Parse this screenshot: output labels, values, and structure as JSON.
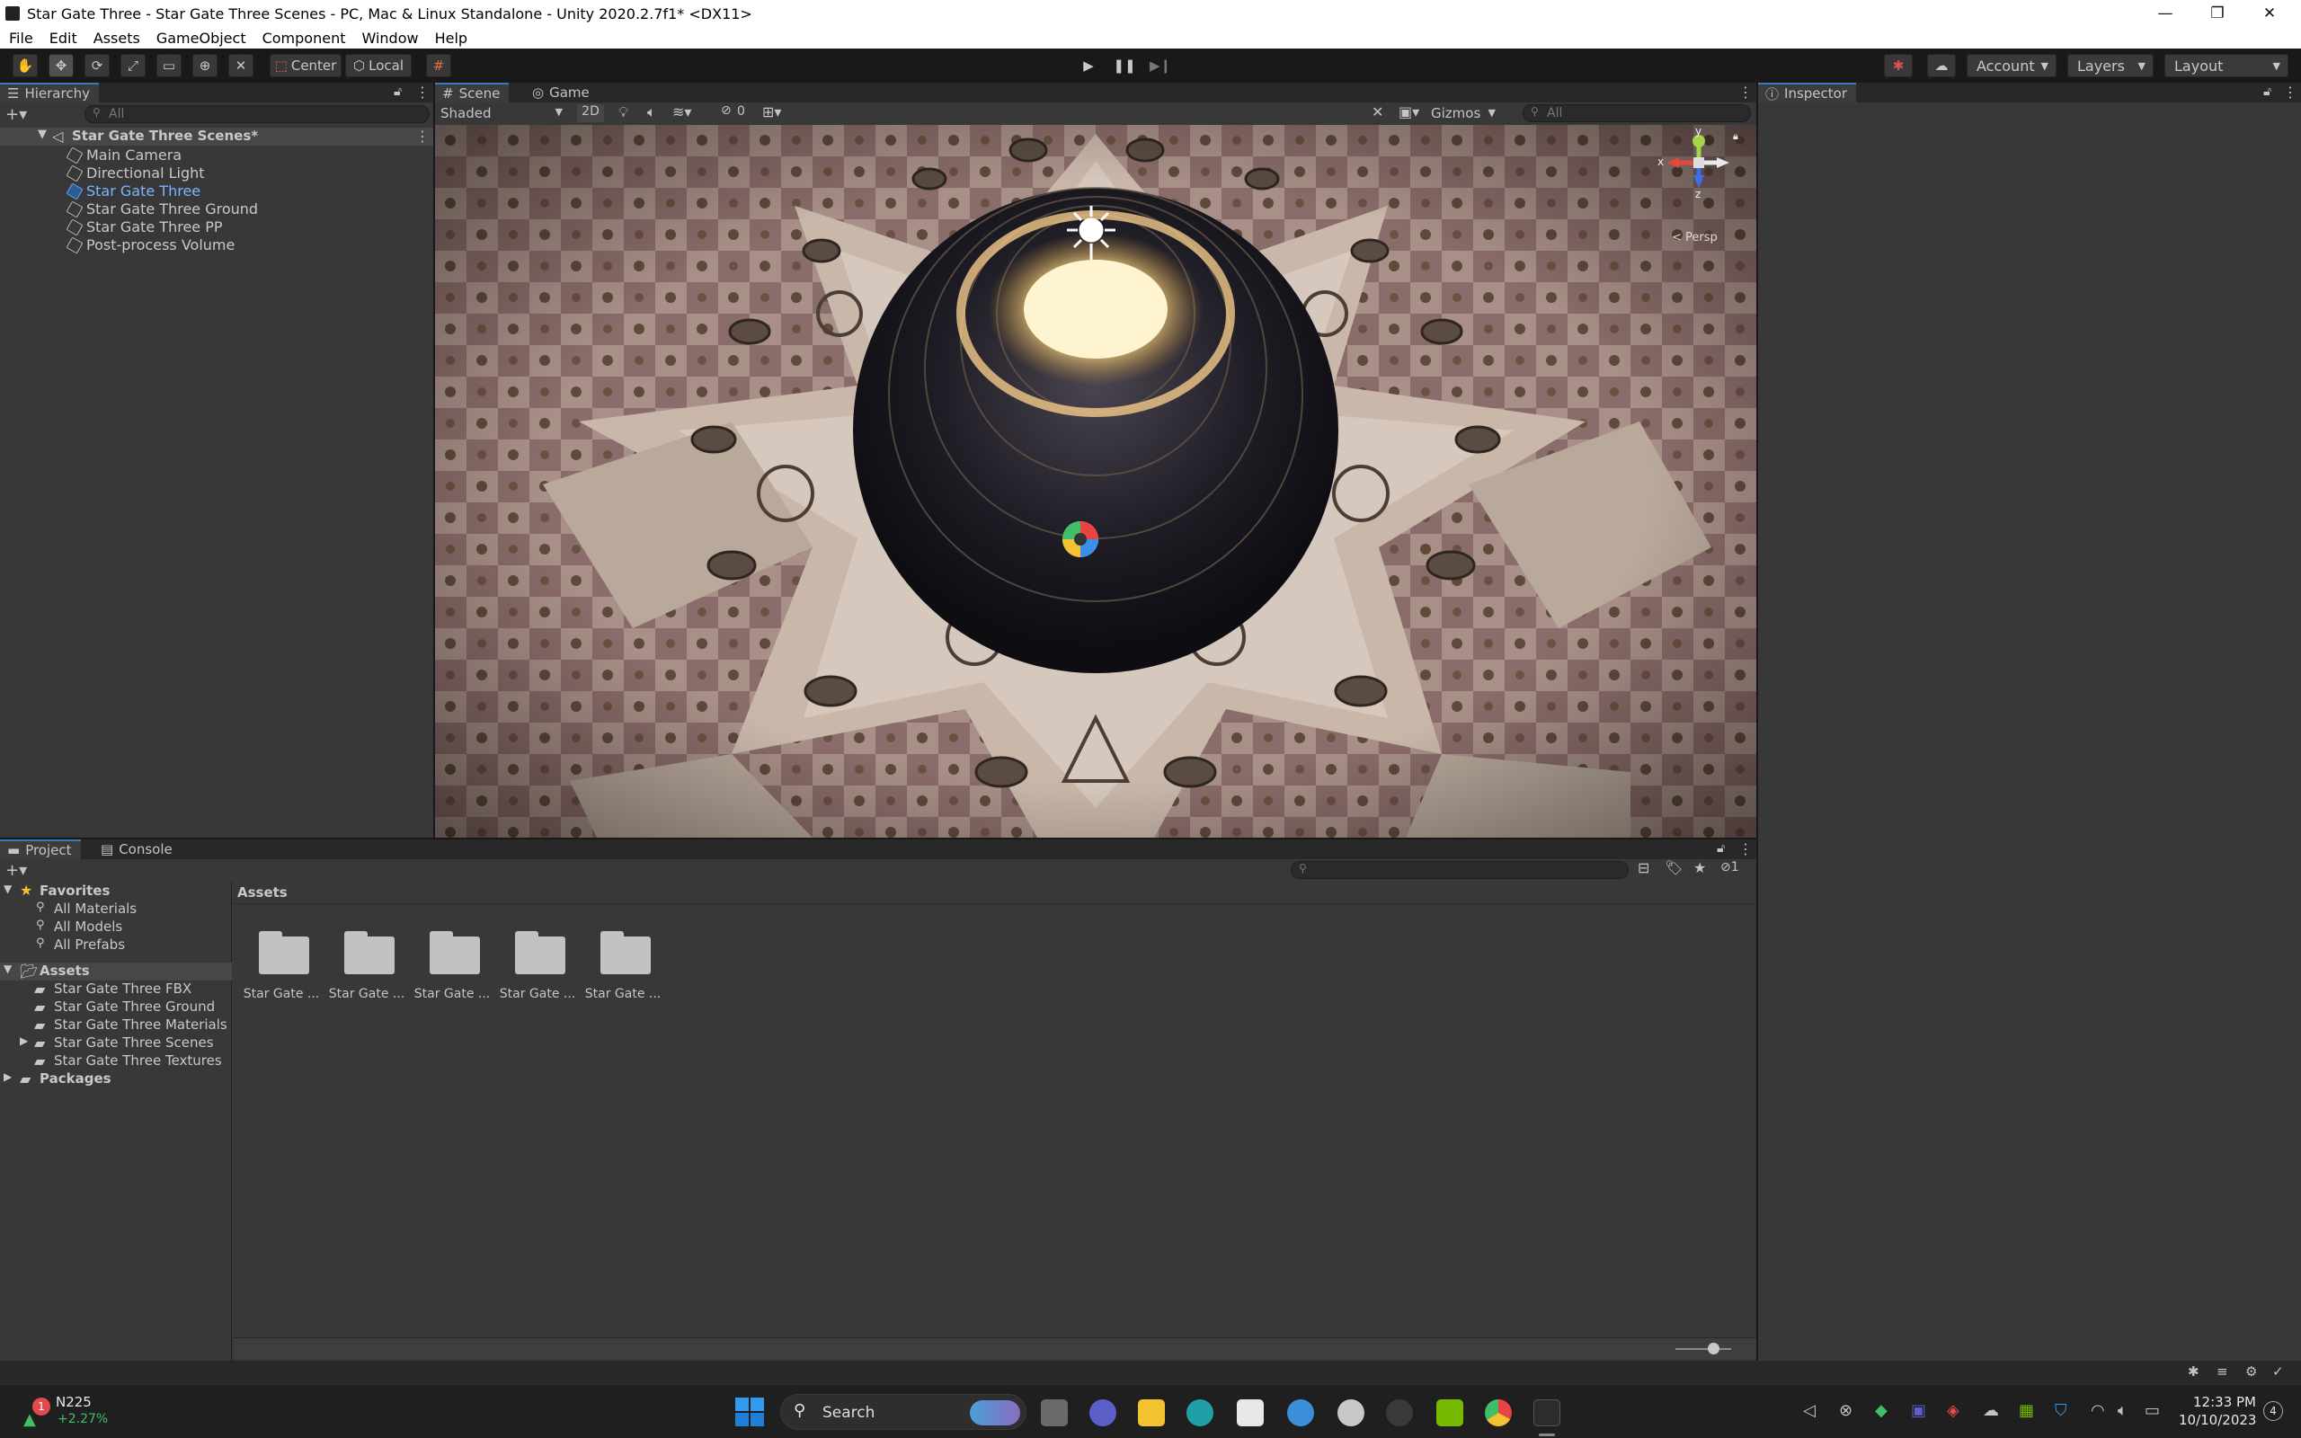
{
  "window": {
    "title": "Star Gate Three - Star Gate Three Scenes - PC, Mac & Linux Standalone - Unity 2020.2.7f1* <DX11>",
    "controls": [
      "—",
      "❐",
      "✕"
    ]
  },
  "menu": [
    "File",
    "Edit",
    "Assets",
    "GameObject",
    "Component",
    "Window",
    "Help"
  ],
  "toolbar": {
    "pivot_label": "Center",
    "space_label": "Local",
    "account_label": "Account",
    "layers_label": "Layers",
    "layout_label": "Layout",
    "play_controls": [
      "play",
      "pause",
      "step"
    ]
  },
  "hierarchy": {
    "tab_label": "Hierarchy",
    "search_placeholder": "All",
    "scene_name": "Star Gate Three Scenes*",
    "items": [
      {
        "label": "Main Camera",
        "selected": false
      },
      {
        "label": "Directional Light",
        "selected": false
      },
      {
        "label": "Star Gate Three",
        "selected": true
      },
      {
        "label": "Star Gate Three Ground",
        "selected": false
      },
      {
        "label": "Star Gate Three PP",
        "selected": false
      },
      {
        "label": "Post-process Volume",
        "selected": false
      }
    ]
  },
  "scene_view": {
    "tabs": [
      "Scene",
      "Game"
    ],
    "shading_mode": "Shaded",
    "mode_2d": "2D",
    "hidden_count": "0",
    "gizmos_label": "Gizmos",
    "search_placeholder": "All",
    "axis_labels": {
      "y": "y",
      "x": "x",
      "z": "z"
    },
    "projection_label": "< Persp"
  },
  "inspector": {
    "tab_label": "Inspector"
  },
  "project": {
    "tabs": [
      "Project",
      "Console"
    ],
    "breadcrumb": "Assets",
    "hidden_packages_count": "1",
    "favorites": {
      "label": "Favorites",
      "items": [
        "All Materials",
        "All Models",
        "All Prefabs"
      ]
    },
    "assets_tree": {
      "label": "Assets",
      "items": [
        "Star Gate Three FBX",
        "Star Gate Three Ground",
        "Star Gate Three Materials",
        "Star Gate Three Scenes",
        "Star Gate Three Textures"
      ]
    },
    "packages_label": "Packages",
    "grid_items": [
      "Star Gate ...",
      "Star Gate ...",
      "Star Gate ...",
      "Star Gate ...",
      "Star Gate ..."
    ]
  },
  "taskbar": {
    "stock_name": "N225",
    "stock_change": "+2.27%",
    "stock_badge": "1",
    "search_label": "Search",
    "time": "12:33 PM",
    "date": "10/10/2023",
    "notification_count": "4"
  },
  "colors": {
    "accent": "#3a79bb",
    "selected_text": "#7cb4ff",
    "panel": "#383838",
    "windows_blue": "#0078d4"
  }
}
